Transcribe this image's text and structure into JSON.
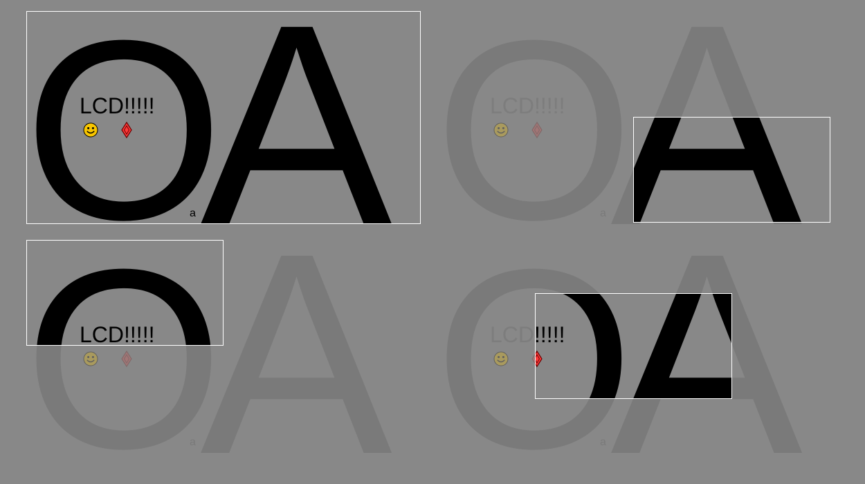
{
  "colors": {
    "background": "#888888",
    "glyph_strong": "#000000",
    "glyph_faded": "#7a7a7a",
    "frame": "#ffffff",
    "smiley_fill": "#f7c500",
    "diamond_fill": "#ff3b3b"
  },
  "text": {
    "big_o": "O",
    "big_a": "A",
    "lcd": "LCD!!!!!",
    "small_a": "a"
  },
  "icons": {
    "smiley": "smiley-face-icon",
    "diamond": "red-diamond-icon"
  }
}
